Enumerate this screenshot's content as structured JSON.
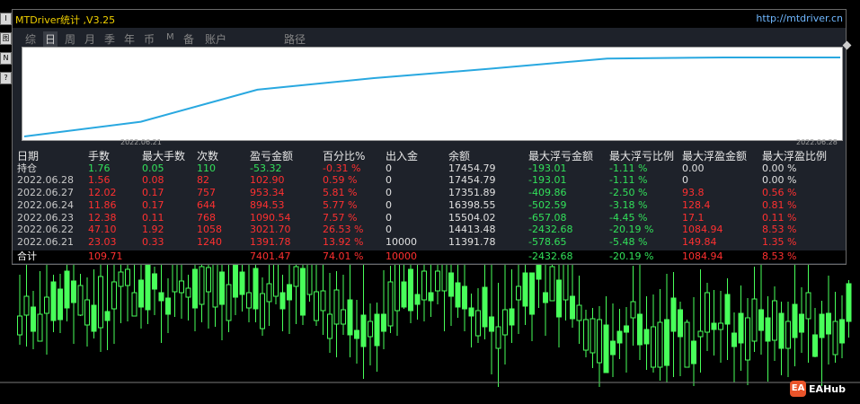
{
  "window": {
    "title": "MTDriver统计 ,V3.25",
    "link": "http://mtdriver.cn"
  },
  "side_buttons": [
    "I",
    "图",
    "N",
    "?"
  ],
  "tabs": [
    {
      "label": "综",
      "active": false
    },
    {
      "label": "日",
      "active": true
    },
    {
      "label": "周",
      "active": false
    },
    {
      "label": "月",
      "active": false
    },
    {
      "label": "季",
      "active": false
    },
    {
      "label": "年",
      "active": false
    },
    {
      "label": "币",
      "active": false
    },
    {
      "label": "M",
      "active": false
    },
    {
      "label": "备",
      "active": false
    },
    {
      "label": "账户",
      "active": false
    },
    {
      "label": "路径",
      "active": false
    }
  ],
  "equity_chart": {
    "x_start_label": "2022.06.21",
    "x_end_label": "2022.06.28",
    "line_color": "#29a8e0",
    "dates": [
      "2022.06.21",
      "2022.06.22",
      "2022.06.23",
      "2022.06.24",
      "2022.06.27",
      "2022.06.28",
      "持仓"
    ],
    "balance": [
      11391.78,
      14413.48,
      15504.02,
      16398.55,
      17351.89,
      17454.79,
      17454.79
    ]
  },
  "colors": {
    "profit": "#32e05a",
    "loss": "#ff3030",
    "neutral": "#e0e0e0",
    "accent_title": "#f0d000",
    "link": "#6fb7ff"
  },
  "table": {
    "headers": [
      "日期",
      "手数",
      "最大手数",
      "次数",
      "盈亏金额",
      "百分比%",
      "出入金",
      "余额",
      "最大浮亏金额",
      "最大浮亏比例",
      "最大浮盈金额",
      "最大浮盈比例"
    ],
    "rows": [
      {
        "date": "持仓",
        "lots": "1.76",
        "max_lots": "0.05",
        "count": "110",
        "pnl": "-53.32",
        "pct": "-0.31 %",
        "deposit": "0",
        "balance": "17454.79",
        "max_dd_amt": "-193.01",
        "max_dd_pct": "-1.11 %",
        "max_fp_amt": "0.00",
        "max_fp_pct": "0.00 %",
        "tone": "open"
      },
      {
        "date": "2022.06.28",
        "lots": "1.56",
        "max_lots": "0.08",
        "count": "82",
        "pnl": "102.90",
        "pct": "0.59 %",
        "deposit": "0",
        "balance": "17454.79",
        "max_dd_amt": "-193.01",
        "max_dd_pct": "-1.11 %",
        "max_fp_amt": "0",
        "max_fp_pct": "0.00 %",
        "tone": "day"
      },
      {
        "date": "2022.06.27",
        "lots": "12.02",
        "max_lots": "0.17",
        "count": "757",
        "pnl": "953.34",
        "pct": "5.81 %",
        "deposit": "0",
        "balance": "17351.89",
        "max_dd_amt": "-409.86",
        "max_dd_pct": "-2.50 %",
        "max_fp_amt": "93.8",
        "max_fp_pct": "0.56 %",
        "tone": "day"
      },
      {
        "date": "2022.06.24",
        "lots": "11.86",
        "max_lots": "0.17",
        "count": "644",
        "pnl": "894.53",
        "pct": "5.77 %",
        "deposit": "0",
        "balance": "16398.55",
        "max_dd_amt": "-502.59",
        "max_dd_pct": "-3.18 %",
        "max_fp_amt": "128.4",
        "max_fp_pct": "0.81 %",
        "tone": "day"
      },
      {
        "date": "2022.06.23",
        "lots": "12.38",
        "max_lots": "0.11",
        "count": "768",
        "pnl": "1090.54",
        "pct": "7.57 %",
        "deposit": "0",
        "balance": "15504.02",
        "max_dd_amt": "-657.08",
        "max_dd_pct": "-4.45 %",
        "max_fp_amt": "17.1",
        "max_fp_pct": "0.11 %",
        "tone": "day"
      },
      {
        "date": "2022.06.22",
        "lots": "47.10",
        "max_lots": "1.92",
        "count": "1058",
        "pnl": "3021.70",
        "pct": "26.53 %",
        "deposit": "0",
        "balance": "14413.48",
        "max_dd_amt": "-2432.68",
        "max_dd_pct": "-20.19 %",
        "max_fp_amt": "1084.94",
        "max_fp_pct": "8.53 %",
        "tone": "day"
      },
      {
        "date": "2022.06.21",
        "lots": "23.03",
        "max_lots": "0.33",
        "count": "1240",
        "pnl": "1391.78",
        "pct": "13.92 %",
        "deposit": "10000",
        "balance": "11391.78",
        "max_dd_amt": "-578.65",
        "max_dd_pct": "-5.48 %",
        "max_fp_amt": "149.84",
        "max_fp_pct": "1.35 %",
        "tone": "day"
      }
    ],
    "total": {
      "date": "合计",
      "lots": "109.71",
      "max_lots": "",
      "count": "",
      "pnl": "7401.47",
      "pct": "74.01 %",
      "deposit": "10000",
      "balance": "",
      "max_dd_amt": "-2432.68",
      "max_dd_pct": "-20.19 %",
      "max_fp_amt": "1084.94",
      "max_fp_pct": "8.53 %"
    }
  },
  "watermark": {
    "badge": "EA",
    "text": "EAHub"
  }
}
